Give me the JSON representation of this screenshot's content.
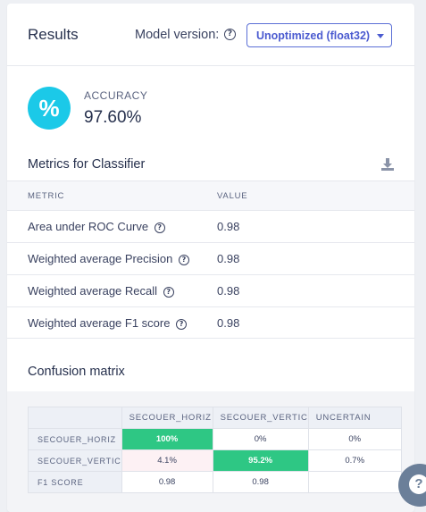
{
  "header": {
    "title": "Results",
    "model_version_label": "Model version:",
    "help_glyph": "?",
    "selected_model": "Unoptimized (float32)"
  },
  "accuracy": {
    "icon_glyph": "%",
    "label": "ACCURACY",
    "value": "97.60%"
  },
  "metrics": {
    "title": "Metrics for Classifier",
    "columns": [
      "METRIC",
      "VALUE"
    ],
    "rows": [
      {
        "metric": "Area under ROC Curve",
        "value": "0.98"
      },
      {
        "metric": "Weighted average Precision",
        "value": "0.98"
      },
      {
        "metric": "Weighted average Recall",
        "value": "0.98"
      },
      {
        "metric": "Weighted average F1 score",
        "value": "0.98"
      }
    ]
  },
  "confusion": {
    "title": "Confusion matrix",
    "columns": [
      "SECOUER_HORIZ",
      "SECOUER_VERTIC",
      "UNCERTAIN"
    ],
    "rows": [
      {
        "label": "SECOUER_HORIZ",
        "cells": [
          "100%",
          "0%",
          "0%"
        ]
      },
      {
        "label": "SECOUER_VERTIC",
        "cells": [
          "4.1%",
          "95.2%",
          "0.7%"
        ]
      },
      {
        "label": "F1 SCORE",
        "cells": [
          "0.98",
          "0.98",
          ""
        ]
      }
    ]
  },
  "help_fab": {
    "glyph": "?"
  },
  "colors": {
    "accent": "#4b5bd0",
    "accuracy_circle": "#1bc9e8",
    "highlight": "#2ec784"
  }
}
